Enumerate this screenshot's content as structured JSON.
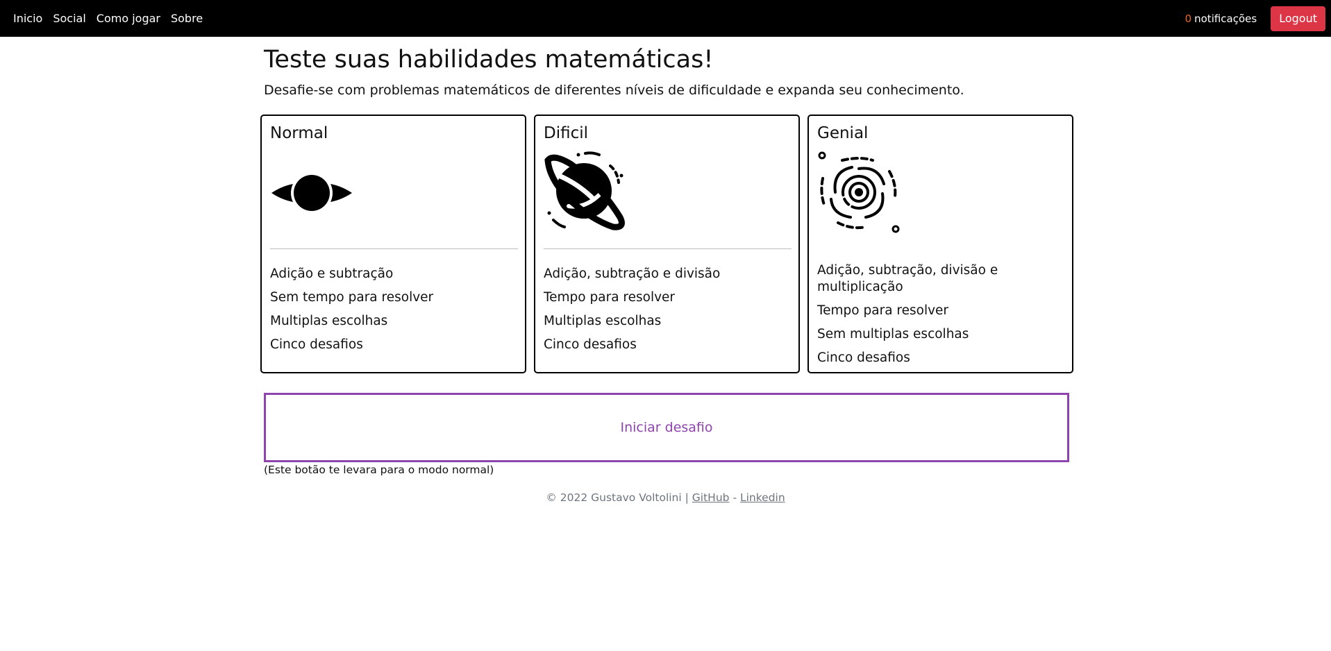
{
  "nav": {
    "links": [
      "Inicio",
      "Social",
      "Como jogar",
      "Sobre"
    ],
    "notification_count": "0",
    "notification_label": "notificações",
    "logout_label": "Logout"
  },
  "header": {
    "title": "Teste suas habilidades matemáticas!",
    "subtitle": "Desafie-se com problemas matemáticos de diferentes níveis de dificuldade e expanda seu conhecimento."
  },
  "levels": [
    {
      "title": "Normal",
      "icon": "black-hole-eye-icon",
      "features": [
        "Adição e subtração",
        "Sem tempo para resolver",
        "Multiplas escolhas",
        "Cinco desafios"
      ]
    },
    {
      "title": "Dificil",
      "icon": "ringed-planet-icon",
      "features": [
        "Adição, subtração e divisão",
        "Tempo para resolver",
        "Multiplas escolhas",
        "Cinco desafios"
      ]
    },
    {
      "title": "Genial",
      "icon": "spiral-galaxy-icon",
      "features": [
        "Adição, subtração, divisão e multiplicação",
        "Tempo para resolver",
        "Sem multiplas escolhas",
        "Cinco desafios"
      ]
    }
  ],
  "start": {
    "label": "Iniciar desafio",
    "note": "(Este botão te levara para o modo normal)"
  },
  "footer": {
    "copyright": "© 2022 Gustavo Voltolini |",
    "github": "GitHub",
    "separator": "-",
    "linkedin": "Linkedin"
  },
  "colors": {
    "navbar_bg": "#000000",
    "logout_bg": "#dc3545",
    "notification_count": "#e8692c",
    "start_button_accent": "#8e44ad",
    "footer_text": "#6c757d"
  }
}
